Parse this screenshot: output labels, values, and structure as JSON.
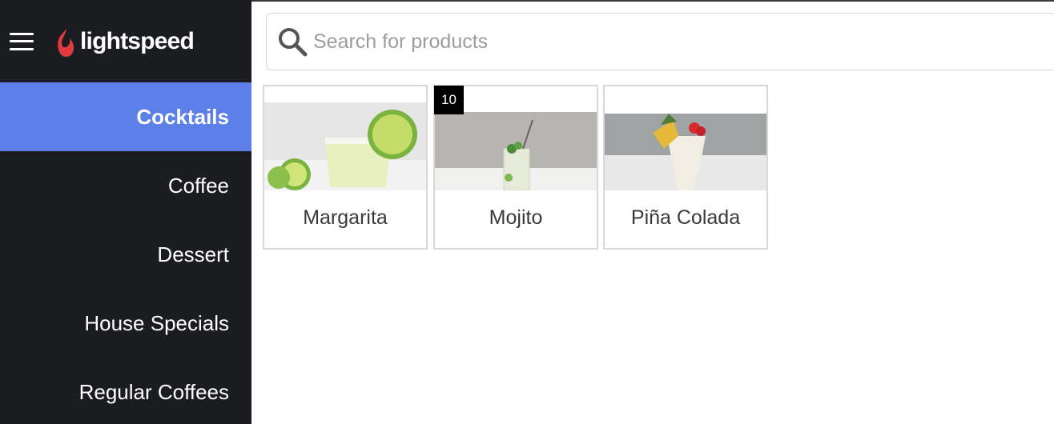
{
  "brand": {
    "name": "lightspeed"
  },
  "colors": {
    "sidebar_bg": "#1b1c20",
    "active_bg": "#5d7fe8",
    "brand_red": "#e03a3e"
  },
  "search": {
    "placeholder": "Search for products",
    "value": ""
  },
  "sidebar": {
    "items": [
      {
        "label": "Cocktails",
        "active": true
      },
      {
        "label": "Coffee"
      },
      {
        "label": "Dessert"
      },
      {
        "label": "House Specials"
      },
      {
        "label": "Regular Coffees"
      }
    ]
  },
  "products": [
    {
      "name": "Margarita",
      "image": "margarita-photo"
    },
    {
      "name": "Mojito",
      "image": "mojito-photo",
      "badge": "10"
    },
    {
      "name": "Piña Colada",
      "image": "pina-colada-photo"
    }
  ]
}
